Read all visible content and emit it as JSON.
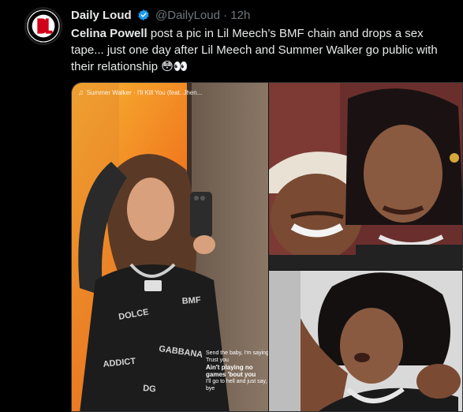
{
  "tweet": {
    "author_name": "Daily Loud",
    "handle": "@DailyLoud",
    "separator": "·",
    "time": "12h",
    "text_bold": "Celina Powell",
    "text_rest": " post a pic in Lil Meech’s BMF chain and drops a sex tape... just one day after Lil Meech and Summer Walker go public with their relationship ",
    "text_emoji": "😳👀"
  },
  "avatar": {
    "logo_text": "DL",
    "ring_text": "DAILY LOUD"
  },
  "media": {
    "left_image": {
      "music_label": "Summer Walker · I'll Kill You (feat. Jhen...",
      "caption_top": "Send the baby, I'm saying Trust you",
      "caption_bold": "Ain't playing no games 'bout you",
      "caption_bottom": "I'll go to hell and just say, bye"
    }
  },
  "colors": {
    "accent": "#1d9bf0",
    "avatar_red": "#d0021b"
  }
}
